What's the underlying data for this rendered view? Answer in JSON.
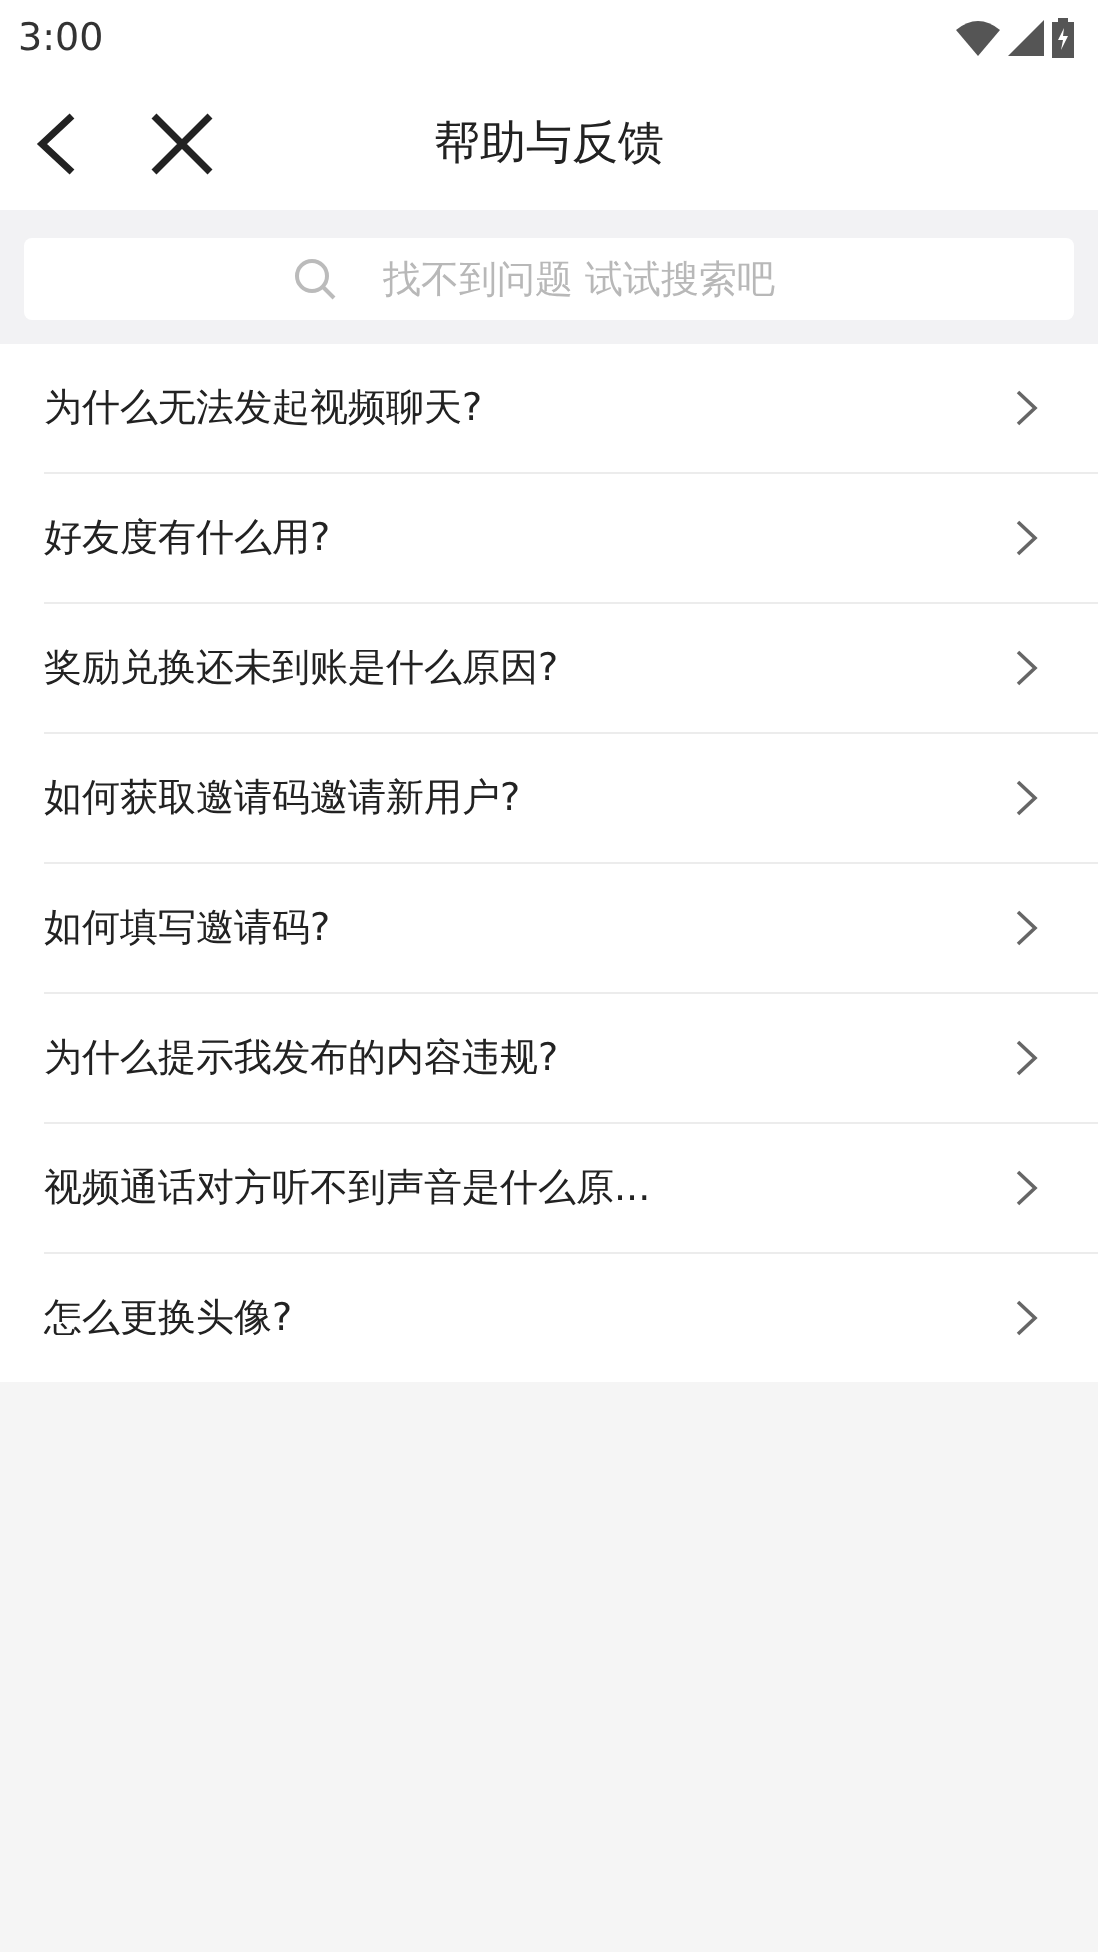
{
  "status_bar": {
    "time": "3:00"
  },
  "header": {
    "title": "帮助与反馈"
  },
  "search": {
    "placeholder": "找不到问题 试试搜索吧"
  },
  "questions": [
    {
      "text": "为什么无法发起视频聊天?"
    },
    {
      "text": "好友度有什么用?"
    },
    {
      "text": "奖励兑换还未到账是什么原因?"
    },
    {
      "text": "如何获取邀请码邀请新用户?"
    },
    {
      "text": "如何填写邀请码?"
    },
    {
      "text": "为什么提示我发布的内容违规?"
    },
    {
      "text": "视频通话对方听不到声音是什么原..."
    },
    {
      "text": "怎么更换头像?"
    }
  ]
}
